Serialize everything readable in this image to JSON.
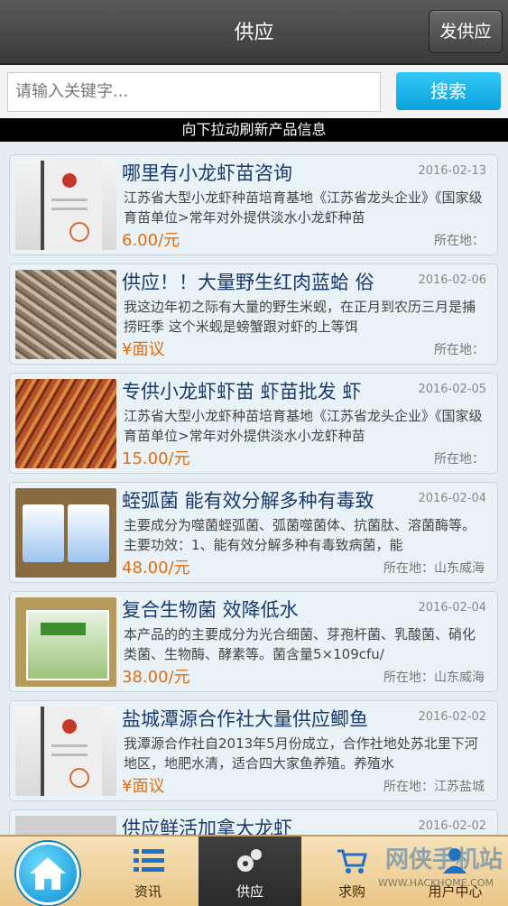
{
  "header": {
    "title": "供应",
    "post_button": "发供应"
  },
  "search": {
    "placeholder": "请输入关键字...",
    "button": "搜索"
  },
  "hint": "向下拉动刷新产品信息",
  "items": [
    {
      "title": "哪里有小龙虾苗咨询",
      "date": "2016-02-13",
      "desc": "江苏省大型小龙虾种苗培育基地《江苏省龙头企业》《国家级育苗单位>常年对外提供淡水小龙虾种苗",
      "price": "6.00/元",
      "location": "所在地："
    },
    {
      "title": "供应！！大量野生红肉蓝蛤 俗",
      "date": "2016-02-06",
      "desc": "我这边年初之际有大量的野生米蚬，在正月到农历三月是捕捞旺季 这个米蚬是螃蟹跟对虾的上等饵",
      "price": "¥面议",
      "location": "所在地："
    },
    {
      "title": "专供小龙虾虾苗 虾苗批发 虾",
      "date": "2016-02-05",
      "desc": "江苏省大型小龙虾种苗培育基地《江苏省龙头企业》《国家级育苗单位>常年对外提供淡水小龙虾种苗",
      "price": "15.00/元",
      "location": "所在地："
    },
    {
      "title": "蛭弧菌 能有效分解多种有毒致",
      "date": "2016-02-04",
      "desc": "主要成分为噬菌蛭弧菌、弧菌噬菌体、抗菌肽、溶菌酶等。主要功效：1、能有效分解多种有毒致病菌，能",
      "price": "48.00/元",
      "location": "所在地：山东威海"
    },
    {
      "title": "复合生物菌 效降低水",
      "date": "2016-02-04",
      "desc": "本产品的的主要成分为光合细菌、芽孢杆菌、乳酸菌、硝化类菌、生物酶、酵素等。菌含量5×109cfu/",
      "price": "38.00/元",
      "location": "所在地：山东威海"
    },
    {
      "title": "盐城潭源合作社大量供应鲫鱼",
      "date": "2016-02-02",
      "desc": "我潭源合作社自2013年5月份成立，合作社地处苏北里下河地区，地肥水清，适合四大家鱼养殖。养殖水",
      "price": "¥面议",
      "location": "所在地：江苏盐城"
    },
    {
      "title": "供应鲜活加拿大龙虾",
      "date": "2016-02-02",
      "desc": "",
      "price": "",
      "location": ""
    }
  ],
  "nav": {
    "tab_info": "资讯",
    "tab_supply": "供应",
    "tab_buy": "求购",
    "tab_user": "用户中心"
  },
  "watermark": {
    "text": "网侠手机站",
    "sub": "WWW.HACKHOME.COM"
  },
  "colors": {
    "accent_blue": "#1aaee8",
    "price_orange": "#e06d10",
    "title_navy": "#1a3a6b"
  }
}
